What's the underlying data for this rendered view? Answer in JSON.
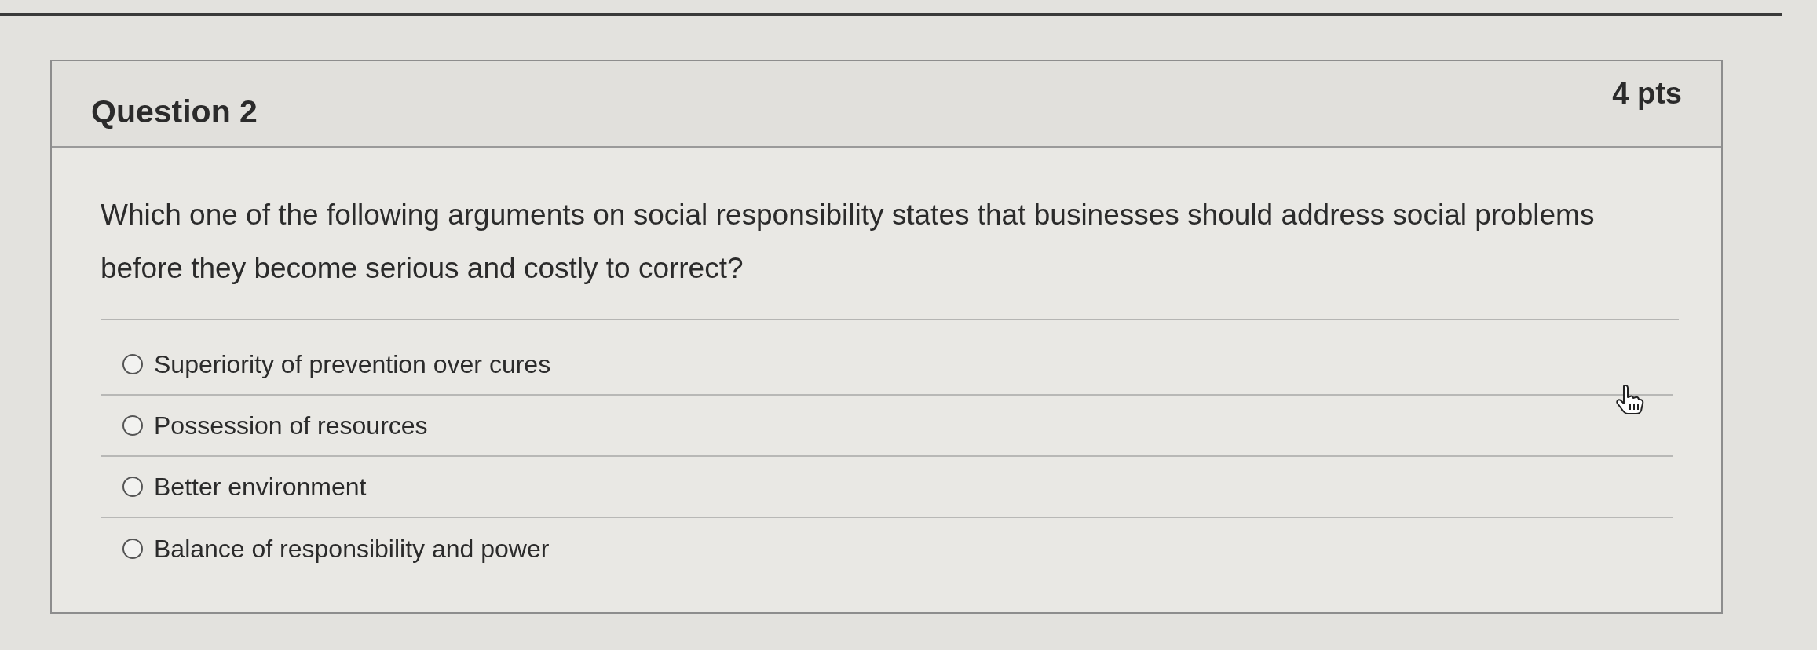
{
  "question": {
    "title": "Question 2",
    "points": "4 pts",
    "text": "Which one of the following arguments on social responsibility states that businesses should address social problems before they become serious and costly to correct?"
  },
  "options": [
    {
      "label": "Superiority of prevention over cures",
      "selected": false
    },
    {
      "label": "Possession of resources",
      "selected": false
    },
    {
      "label": "Better environment",
      "selected": false
    },
    {
      "label": "Balance of responsibility and power",
      "selected": false
    }
  ]
}
